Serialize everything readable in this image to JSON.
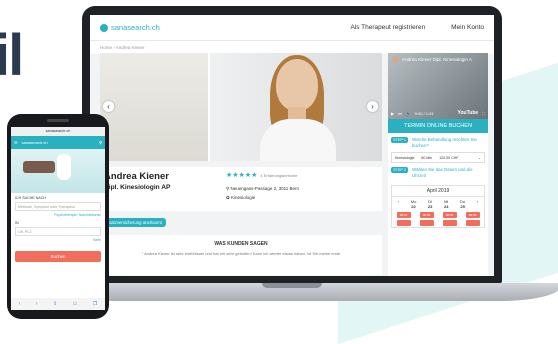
{
  "background_word": "il",
  "laptop": {
    "logo": "sanasearch.ch",
    "nav": [
      "Als Therapeut registrieren",
      "Mein Konto"
    ],
    "breadcrumb": "Home › Andrea Kiener",
    "profile": {
      "name": "Andrea Kiener",
      "title": "Dipl. Kinesiologin AP",
      "stars": "★★★★★",
      "rating_text": "4 Erfahrungsberichte",
      "address": "Neuengass-Passage 2, 3011 Bern",
      "specialty": "Kinesiologie",
      "badge": "Zusatzversicherung anerkannt"
    },
    "reviews": {
      "heading": "WAS KUNDEN SAGEN",
      "quote": "\" Andrea Kiener ist sehr einfühlsam und hat mir sehr geholfen! Kann ich wieder etwas haben, ist Sie meine erste"
    },
    "video": {
      "title": "Andrea Kiener Dipl. Kinesiologin A",
      "time": "0:00 / 1:31",
      "brand": "YouTube"
    },
    "booking": {
      "heading": "TERMIN ONLINE BUCHEN",
      "step1_badge": "STEP 1",
      "step1_text": "Welche Behandlung möchten Sie buchen?",
      "treatment": "Kinesiologie",
      "duration": "60 Min",
      "price": "120.00 CHF",
      "step2_badge": "STEP 2",
      "step2_text": "Wählen Sie das Datum und die Uhrzeit",
      "month": "April 2019",
      "days": [
        {
          "name": "Mo",
          "num": "22"
        },
        {
          "name": "Di",
          "num": "23"
        },
        {
          "name": "Mi",
          "num": "24"
        },
        {
          "name": "Do",
          "num": "25"
        }
      ],
      "slot_label": "08:30"
    }
  },
  "phone": {
    "url": "sanasearch.ch",
    "logo": "sanasearch.ch",
    "search_label": "ICH SUCHE NACH",
    "search_placeholder": "Methode, Symptom oder Therapeut",
    "link1": "Psychotherapie, Naturheilkunde",
    "in_label": "IN",
    "location_placeholder": "Ort, PLZ",
    "link2": "Karte",
    "button": "Suchen",
    "menu_icon": "☰",
    "user_icon": "⚲"
  }
}
